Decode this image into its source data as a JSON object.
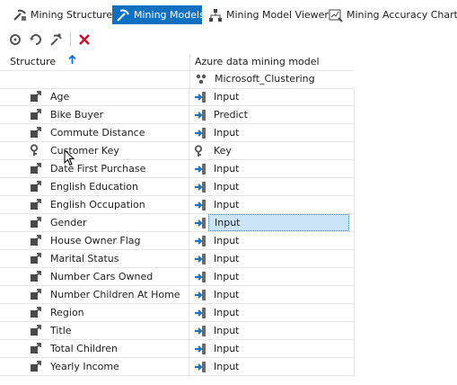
{
  "tabs": [
    {
      "label": "Mining Structure",
      "icon": "mining-structure-icon",
      "active": false
    },
    {
      "label": "Mining Models",
      "icon": "mining-models-icon",
      "active": true
    },
    {
      "label": "Mining Model Viewer",
      "icon": "mining-model-viewer-icon",
      "active": false
    },
    {
      "label": "Mining Accuracy Chart",
      "icon": "mining-accuracy-chart-icon",
      "active": false
    }
  ],
  "toolbar": {
    "buttons": [
      "process-icon",
      "refresh-icon",
      "new-model-icon",
      "delete-icon"
    ]
  },
  "grid": {
    "structure_header": "Structure",
    "model_header": "Azure data mining model",
    "algorithm": "Microsoft_Clustering",
    "rows": [
      {
        "name": "Age",
        "usage": "Input"
      },
      {
        "name": "Bike Buyer",
        "usage": "Predict"
      },
      {
        "name": "Commute Distance",
        "usage": "Input"
      },
      {
        "name": "Customer Key",
        "usage": "Key"
      },
      {
        "name": "Date First Purchase",
        "usage": "Input"
      },
      {
        "name": "English Education",
        "usage": "Input"
      },
      {
        "name": "English Occupation",
        "usage": "Input"
      },
      {
        "name": "Gender",
        "usage": "Input"
      },
      {
        "name": "House Owner Flag",
        "usage": "Input"
      },
      {
        "name": "Marital Status",
        "usage": "Input"
      },
      {
        "name": "Number Cars Owned",
        "usage": "Input"
      },
      {
        "name": "Number Children At Home",
        "usage": "Input"
      },
      {
        "name": "Region",
        "usage": "Input"
      },
      {
        "name": "Title",
        "usage": "Input"
      },
      {
        "name": "Total Children",
        "usage": "Input"
      },
      {
        "name": "Yearly Income",
        "usage": "Input"
      }
    ],
    "selected_row": 7
  },
  "colors": {
    "active_tab": "#0e70c0",
    "selection": "#cce4f7",
    "input_arrow": "#1c6fc7",
    "delete": "#c8102e"
  }
}
